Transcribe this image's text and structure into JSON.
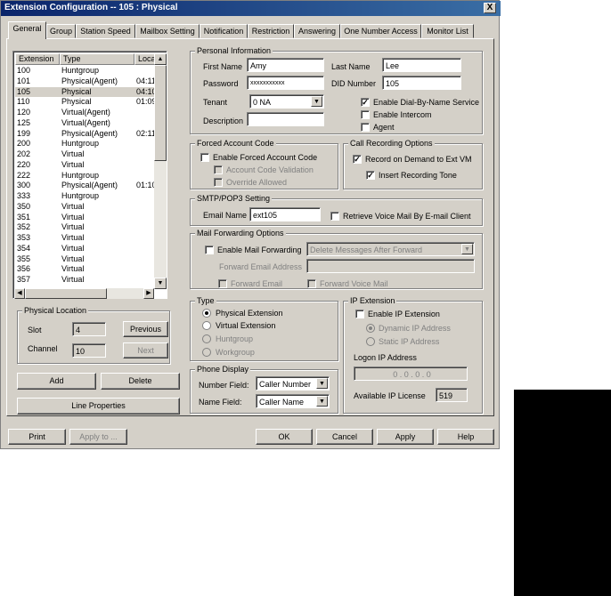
{
  "window": {
    "title": "Extension Configuration -- 105 : Physical",
    "close_label": "X"
  },
  "tabs": [
    "General",
    "Group",
    "Station Speed",
    "Mailbox Setting",
    "Notification",
    "Restriction",
    "Answering",
    "One Number Access",
    "Monitor List"
  ],
  "extension_list": {
    "columns": [
      "Extension",
      "Type",
      "Locatio"
    ],
    "rows": [
      {
        "ext": "100",
        "type": "Huntgroup",
        "loc": ""
      },
      {
        "ext": "101",
        "type": "Physical(Agent)",
        "loc": "04:11"
      },
      {
        "ext": "105",
        "type": "Physical",
        "loc": "04:10"
      },
      {
        "ext": "110",
        "type": "Physical",
        "loc": "01:09"
      },
      {
        "ext": "120",
        "type": "Virtual(Agent)",
        "loc": ""
      },
      {
        "ext": "125",
        "type": "Virtual(Agent)",
        "loc": ""
      },
      {
        "ext": "199",
        "type": "Physical(Agent)",
        "loc": "02:11"
      },
      {
        "ext": "200",
        "type": "Huntgroup",
        "loc": ""
      },
      {
        "ext": "202",
        "type": "Virtual",
        "loc": ""
      },
      {
        "ext": "220",
        "type": "Virtual",
        "loc": ""
      },
      {
        "ext": "222",
        "type": "Huntgroup",
        "loc": ""
      },
      {
        "ext": "300",
        "type": "Physical(Agent)",
        "loc": "01:10"
      },
      {
        "ext": "333",
        "type": "Huntgroup",
        "loc": ""
      },
      {
        "ext": "350",
        "type": "Virtual",
        "loc": ""
      },
      {
        "ext": "351",
        "type": "Virtual",
        "loc": ""
      },
      {
        "ext": "352",
        "type": "Virtual",
        "loc": ""
      },
      {
        "ext": "353",
        "type": "Virtual",
        "loc": ""
      },
      {
        "ext": "354",
        "type": "Virtual",
        "loc": ""
      },
      {
        "ext": "355",
        "type": "Virtual",
        "loc": ""
      },
      {
        "ext": "356",
        "type": "Virtual",
        "loc": ""
      },
      {
        "ext": "357",
        "type": "Virtual",
        "loc": ""
      }
    ]
  },
  "physical_location": {
    "title": "Physical Location",
    "slot_label": "Slot",
    "slot_value": "4",
    "channel_label": "Channel",
    "channel_value": "10",
    "previous_label": "Previous",
    "next_label": "Next"
  },
  "left_buttons": {
    "add": "Add",
    "delete": "Delete",
    "line_properties": "Line Properties"
  },
  "personal_info": {
    "title": "Personal Information",
    "first_name_label": "First Name",
    "first_name": "Amy",
    "last_name_label": "Last Name",
    "last_name": "Lee",
    "password_label": "Password",
    "password": "xxxxxxxxxxx",
    "did_label": "DID Number",
    "did": "105",
    "tenant_label": "Tenant",
    "tenant_value": "0    NA",
    "description_label": "Description",
    "description": "",
    "dial_by_name_label": "Enable Dial-By-Name Service",
    "intercom_label": "Enable Intercom",
    "agent_label": "Agent"
  },
  "forced_account": {
    "title": "Forced Account Code",
    "enable_label": "Enable Forced Account Code",
    "validation_label": "Account Code Validation",
    "override_label": "Override Allowed"
  },
  "call_recording": {
    "title": "Call Recording Options",
    "record_label": "Record on Demand to Ext VM",
    "tone_label": "Insert Recording Tone"
  },
  "smtp": {
    "title": "SMTP/POP3 Setting",
    "email_label": "Email Name",
    "email_value": "ext105",
    "retrieve_label": "Retrieve Voice Mail By E-mail Client"
  },
  "mail_forwarding": {
    "title": "Mail Forwarding Options",
    "enable_label": "Enable Mail Forwarding",
    "action_value": "Delete Messages After Forward",
    "forward_address_label": "Forward Email Address",
    "forward_email_label": "Forward Email",
    "forward_voicemail_label": "Forward Voice Mail"
  },
  "type_group": {
    "title": "Type",
    "physical": "Physical Extension",
    "virtual": "Virtual Extension",
    "huntgroup": "Huntgroup",
    "workgroup": "Workgroup"
  },
  "ip_extension": {
    "title": "IP Extension",
    "enable_label": "Enable IP Extension",
    "dynamic_label": "Dynamic IP Address",
    "static_label": "Static IP Address",
    "logon_label": "Logon IP Address",
    "ip_value": "0  .  0  .  0  .  0",
    "license_label": "Available IP License",
    "license_value": "519"
  },
  "phone_display": {
    "title": "Phone Display",
    "number_label": "Number Field:",
    "number_value": "Caller Number",
    "name_label": "Name Field:",
    "name_value": "Caller Name"
  },
  "bottom_buttons": {
    "print": "Print",
    "apply_to": "Apply to ...",
    "ok": "OK",
    "cancel": "Cancel",
    "apply": "Apply",
    "help": "Help"
  },
  "colors": {
    "title_bar": "#0a246a",
    "dialog_bg": "#d4d0c8",
    "side_panel": "#000000"
  },
  "icons": {
    "close": "close-icon",
    "dropdown": "chevron-down-icon",
    "scroll_up": "scroll-up-icon",
    "scroll_down": "scroll-down-icon",
    "scroll_left": "scroll-left-icon",
    "scroll_right": "scroll-right-icon",
    "check": "check-icon"
  }
}
